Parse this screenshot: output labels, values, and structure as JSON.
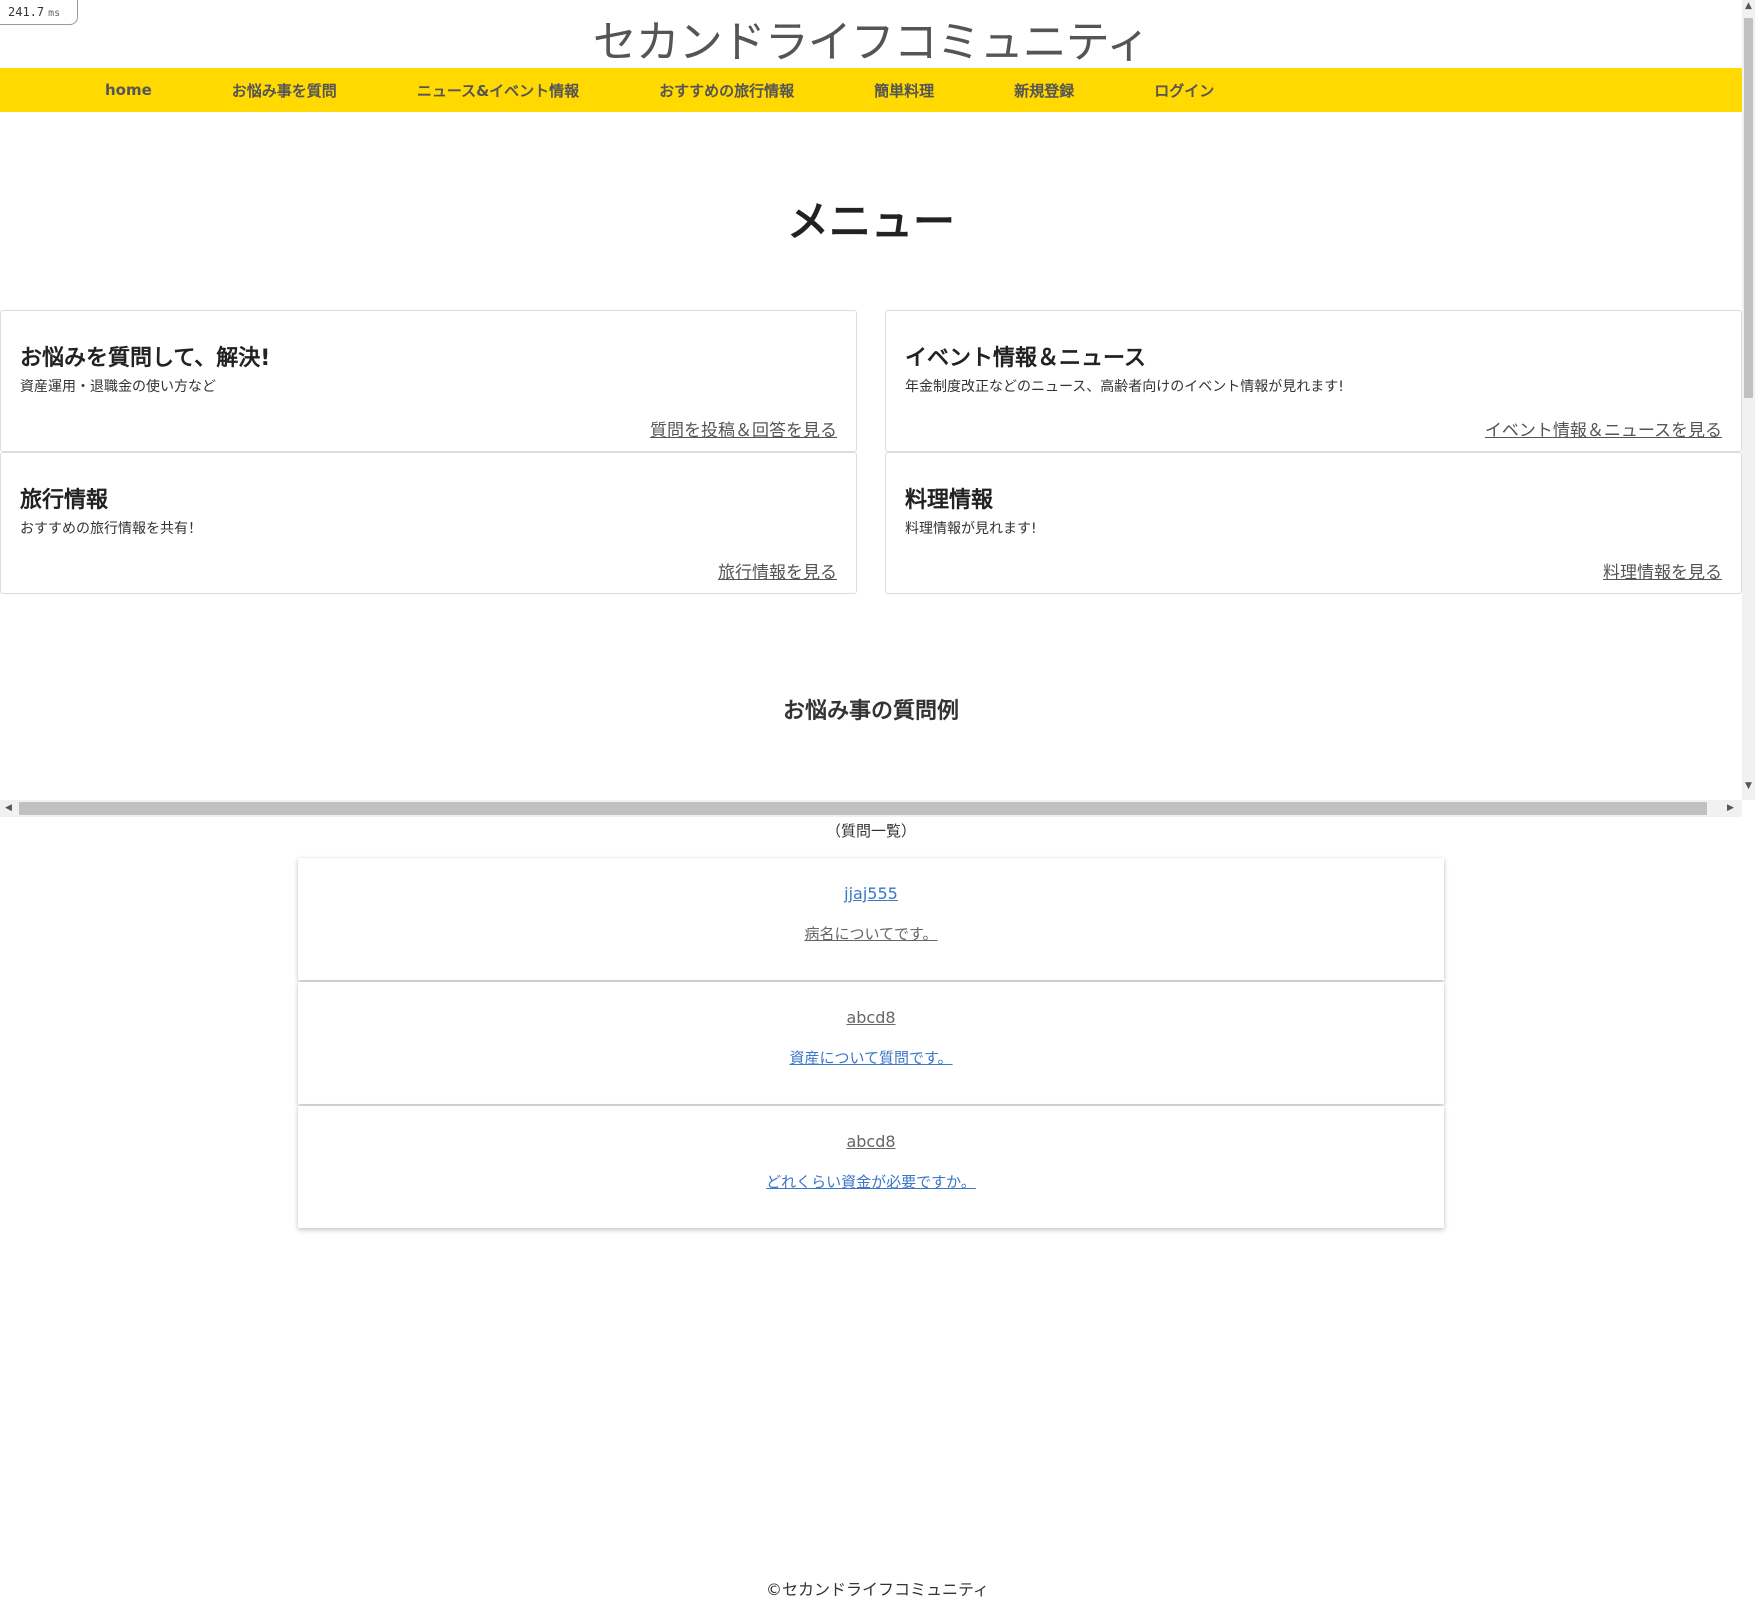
{
  "timing": {
    "value": "241.7",
    "unit": "ms"
  },
  "site": {
    "title": "セカンドライフコミュニティ"
  },
  "nav": {
    "items": [
      {
        "label": "home"
      },
      {
        "label": "お悩み事を質問"
      },
      {
        "label": "ニュース&イベント情報"
      },
      {
        "label": "おすすめの旅行情報"
      },
      {
        "label": "簡単料理"
      },
      {
        "label": "新規登録"
      },
      {
        "label": "ログイン"
      }
    ],
    "background": "#ffd900"
  },
  "menu": {
    "heading": "メニュー",
    "cards": [
      {
        "title": "お悩みを質問して、解決!",
        "description": "資産運用・退職金の使い方など",
        "link": "質問を投稿＆回答を見る"
      },
      {
        "title": "イベント情報＆ニュース",
        "description": "年金制度改正などのニュース、高齢者向けのイベント情報が見れます!",
        "link": "イベント情報＆ニュースを見る"
      },
      {
        "title": "旅行情報",
        "description": "おすすめの旅行情報を共有！",
        "link": "旅行情報を見る"
      },
      {
        "title": "料理情報",
        "description": "料理情報が見れます!",
        "link": "料理情報を見る"
      }
    ]
  },
  "examples": {
    "heading": "お悩み事の質問例",
    "caption": "（質問一覧）",
    "questions": [
      {
        "user": "jjaj555",
        "subject": "病名についてです。",
        "user_color": "blue",
        "subject_color": "gray"
      },
      {
        "user": "abcd8",
        "subject": "資産について質問です。",
        "user_color": "gray",
        "subject_color": "blue"
      },
      {
        "user": "abcd8",
        "subject": "どれくらい資金が必要ですか。",
        "user_color": "gray",
        "subject_color": "blue"
      }
    ]
  },
  "footer": {
    "text": "©セカンドライフコミュニティ"
  },
  "scrollbar": {
    "up_icon": "triangle-up-icon",
    "down_icon": "triangle-down-icon",
    "left_icon": "triangle-left-icon",
    "right_icon": "triangle-right-icon"
  }
}
